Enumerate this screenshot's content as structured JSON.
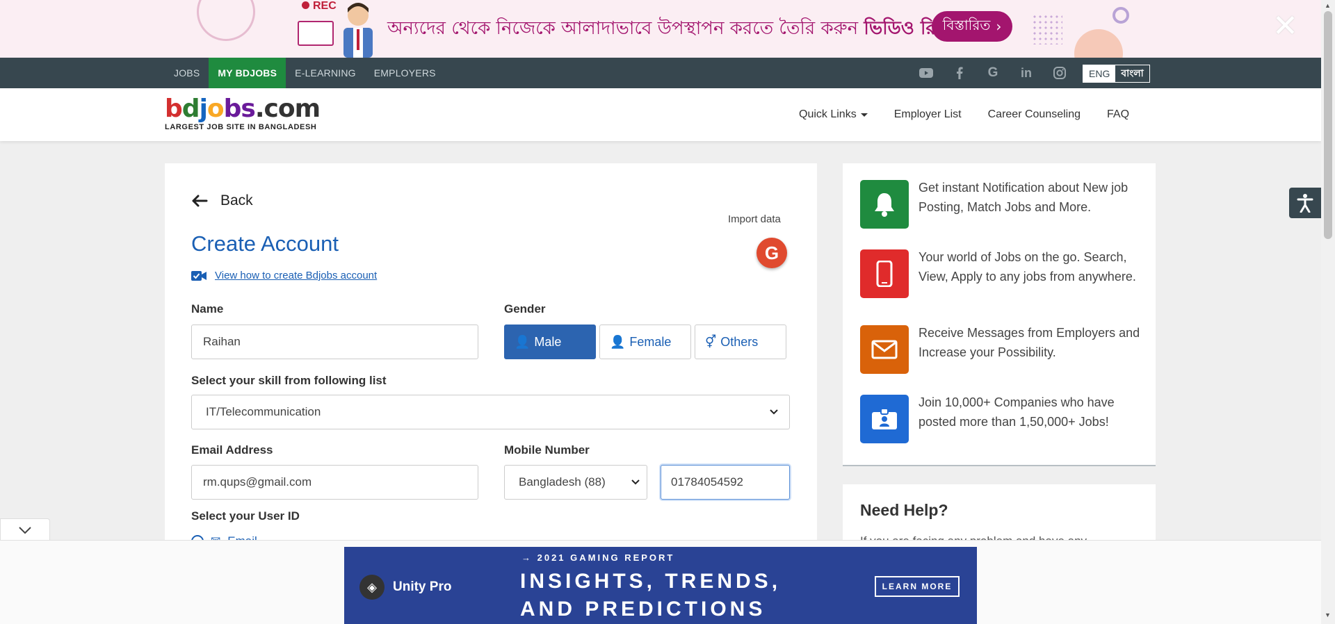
{
  "promo": {
    "rec": "REC",
    "text_part1": "অন্যদের থেকে নিজেকে আলাদাভাবে উপস্থাপন করতে তৈরি করুন ",
    "text_part2": "ভিডিও রিজিউমি।",
    "button": "বিস্তারিত",
    "close_icon": "close-icon"
  },
  "topnav": {
    "items": [
      "JOBS",
      "MY BDJOBS",
      "E-LEARNING",
      "EMPLOYERS"
    ],
    "active_index": 1,
    "social": [
      "youtube-icon",
      "facebook-icon",
      "google-icon",
      "linkedin-icon",
      "instagram-icon"
    ],
    "lang_eng": "ENG",
    "lang_bn": "বাংলা",
    "bg_color": "#37474f",
    "active_color": "#1f8b3f"
  },
  "header": {
    "logo_b": "b",
    "logo_d": "d",
    "logo_j": "j",
    "logo_o": "o",
    "logo_bs": "bs",
    "logo_com": ".com",
    "logo_tagline": "LARGEST JOB SITE IN BANGLADESH",
    "menu": {
      "quick_links": "Quick Links",
      "employer_list": "Employer List",
      "career_counseling": "Career Counseling",
      "faq": "FAQ"
    }
  },
  "form": {
    "back": "Back",
    "import_data": "Import data",
    "google_letter": "G",
    "title": "Create Account",
    "howto_link": "View how to create Bdjobs account",
    "name_label": "Name",
    "name_value": "Raihan",
    "gender_label": "Gender",
    "gender_options": [
      "Male",
      "Female",
      "Others"
    ],
    "gender_selected": "Male",
    "skill_label": "Select your skill from following list",
    "skill_value": "IT/Telecommunication",
    "email_label": "Email Address",
    "email_value": "rm.qups@gmail.com",
    "mobile_label": "Mobile Number",
    "country_value": "Bangladesh (88)",
    "mobile_value": "01784054592",
    "userid_label": "Select your User ID",
    "userid_option": "Email",
    "title_color": "#1a5fb4"
  },
  "sidebar": {
    "features": [
      {
        "icon": "bell-icon",
        "color": "#1f8b3f",
        "text": "Get instant Notification about New job Posting, Match Jobs and More."
      },
      {
        "icon": "mobile-icon",
        "color": "#e02b2b",
        "text": "Your world of Jobs on the go. Search, View, Apply to any jobs from anywhere."
      },
      {
        "icon": "envelope-icon",
        "color": "#d9620a",
        "text": "Receive Messages from Employers and Increase your Possibility."
      },
      {
        "icon": "badge-icon",
        "color": "#1f6ad4",
        "text": "Join 10,000+ Companies who have posted more than 1,50,000+ Jobs!"
      }
    ],
    "help_title": "Need Help?",
    "help_text": "If you are facing any problem and have any"
  },
  "bottom_ad": {
    "brand": "Unity Pro",
    "kicker": "→ 2021 GAMING REPORT",
    "headline1": "INSIGHTS, TRENDS,",
    "headline2": "AND PREDICTIONS",
    "cta": "LEARN MORE",
    "bg_color": "#2a4395"
  }
}
